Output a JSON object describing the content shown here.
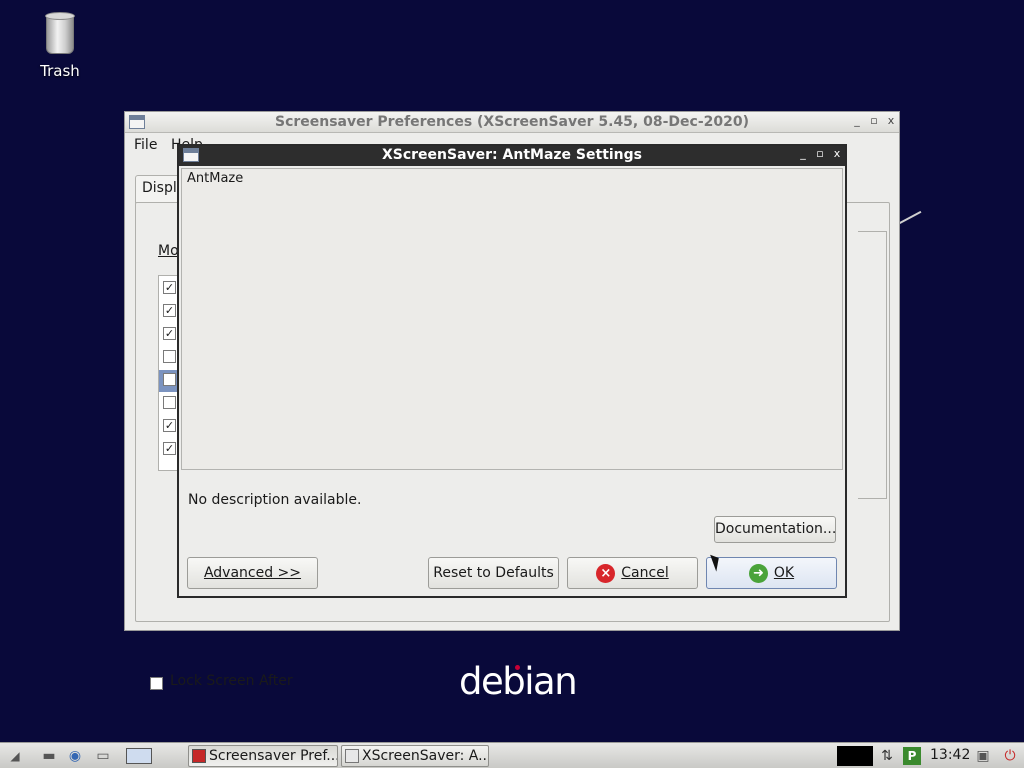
{
  "desktop": {
    "trash_label": "Trash",
    "logo_text": "debian"
  },
  "main_window": {
    "title": "Screensaver Preferences  (XScreenSaver 5.45, 08-Dec-2020)",
    "controls": [
      "_",
      "▫",
      "x"
    ],
    "menu": [
      "File",
      "Help"
    ],
    "tab_label": "Display Modes",
    "mode_label": "Mode:",
    "list_checkboxes": [
      true,
      true,
      true,
      false,
      false,
      false,
      true,
      true
    ],
    "lock_label": "Lock Screen After"
  },
  "settings_dialog": {
    "title": "XScreenSaver: AntMaze Settings",
    "controls": [
      "_",
      "▫",
      "x"
    ],
    "hack_name": "AntMaze",
    "description": "No description available.",
    "buttons": {
      "documentation": "Documentation...",
      "advanced": "Advanced >>",
      "reset": "Reset to Defaults",
      "cancel": "Cancel",
      "ok": "OK"
    }
  },
  "taskbar": {
    "tasks": [
      {
        "label": "Screensaver Pref...",
        "active": true
      },
      {
        "label": "XScreenSaver: A...",
        "active": false
      }
    ],
    "clock": "13:42",
    "tray_p": "P"
  }
}
